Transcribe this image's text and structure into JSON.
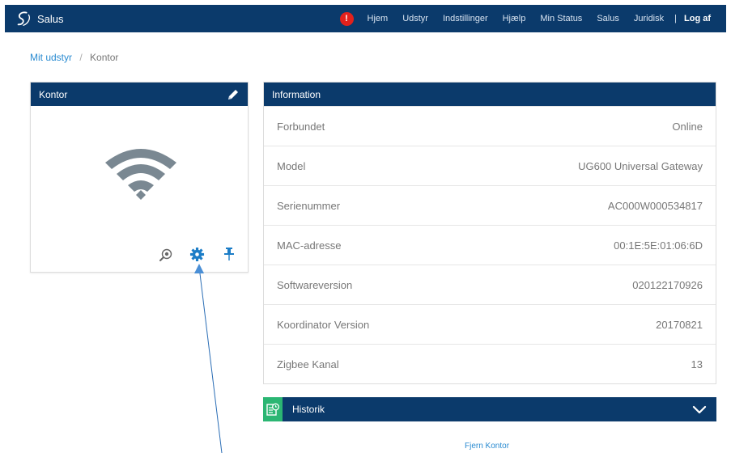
{
  "app": {
    "name": "Salus"
  },
  "nav": {
    "alert_symbol": "!",
    "items": [
      "Hjem",
      "Udstyr",
      "Indstillinger",
      "Hjælp",
      "Min Status",
      "Salus",
      "Juridisk"
    ],
    "separator": "|",
    "logout": "Log af"
  },
  "breadcrumb": {
    "parent": "Mit udstyr",
    "separator": "/",
    "current": "Kontor"
  },
  "device": {
    "title": "Kontor",
    "icons": [
      "pencil-icon",
      "wifi-icon",
      "zoom-icon",
      "gear-icon",
      "pin-icon"
    ]
  },
  "info": {
    "title": "Information",
    "rows": [
      {
        "label": "Forbundet",
        "value": "Online"
      },
      {
        "label": "Model",
        "value": "UG600 Universal Gateway"
      },
      {
        "label": "Serienummer",
        "value": "AC000W000534817"
      },
      {
        "label": "MAC-adresse",
        "value": "00:1E:5E:01:06:6D"
      },
      {
        "label": "Softwareversion",
        "value": "020122170926"
      },
      {
        "label": "Koordinator Version",
        "value": "20170821"
      },
      {
        "label": "Zigbee Kanal",
        "value": "13"
      }
    ]
  },
  "history": {
    "label": "Historik"
  },
  "remove_link": "Fjern Kontor",
  "colors": {
    "navbar": "#0b3a6b",
    "link": "#2a8bd1",
    "alert": "#e2211c",
    "history_icon": "#2bb673",
    "wifi": "#7a8892"
  }
}
